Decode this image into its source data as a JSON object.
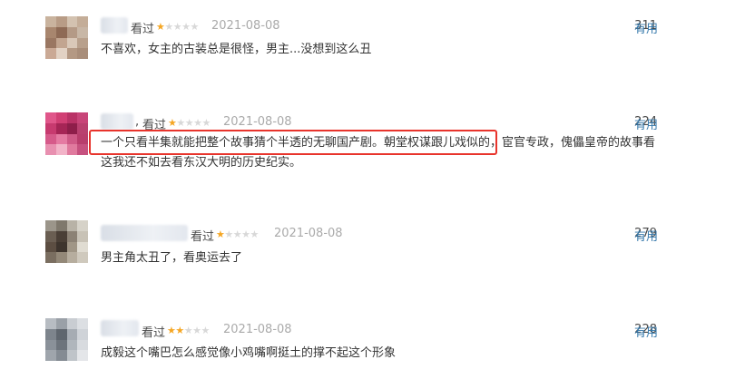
{
  "comments": [
    {
      "status": "看过",
      "rating": 1,
      "date": "2021-08-08",
      "votes": "311",
      "useful_label": "有用",
      "text": "不喜欢，女主的古装总是很怪，男主...没想到这么丑"
    },
    {
      "separator": ",",
      "status": "看过",
      "rating": 1,
      "date": "2021-08-08",
      "votes": "224",
      "useful_label": "有用",
      "text_line1": "一个只看半集就能把整个故事猜个半透的无聊国产剧。朝堂权谋跟儿戏似的，宦官专政，傀儡皇帝的故事看",
      "text_line2": "这我还不如去看东汉大明的历史纪实。"
    },
    {
      "status": "看过",
      "rating": 1,
      "date": "2021-08-08",
      "votes": "279",
      "useful_label": "有用",
      "text": "男主角太丑了，看奥运去了"
    },
    {
      "status": "看过",
      "rating": 2,
      "date": "2021-08-08",
      "votes": "228",
      "useful_label": "有用",
      "text": "成毅这个嘴巴怎么感觉像小鸡嘴啊挺土的撑不起这个形象"
    }
  ],
  "colors": {
    "star_on": "#f5a623",
    "star_off": "#d8d8d8",
    "link": "#3377aa",
    "highlight": "#e8342c"
  }
}
